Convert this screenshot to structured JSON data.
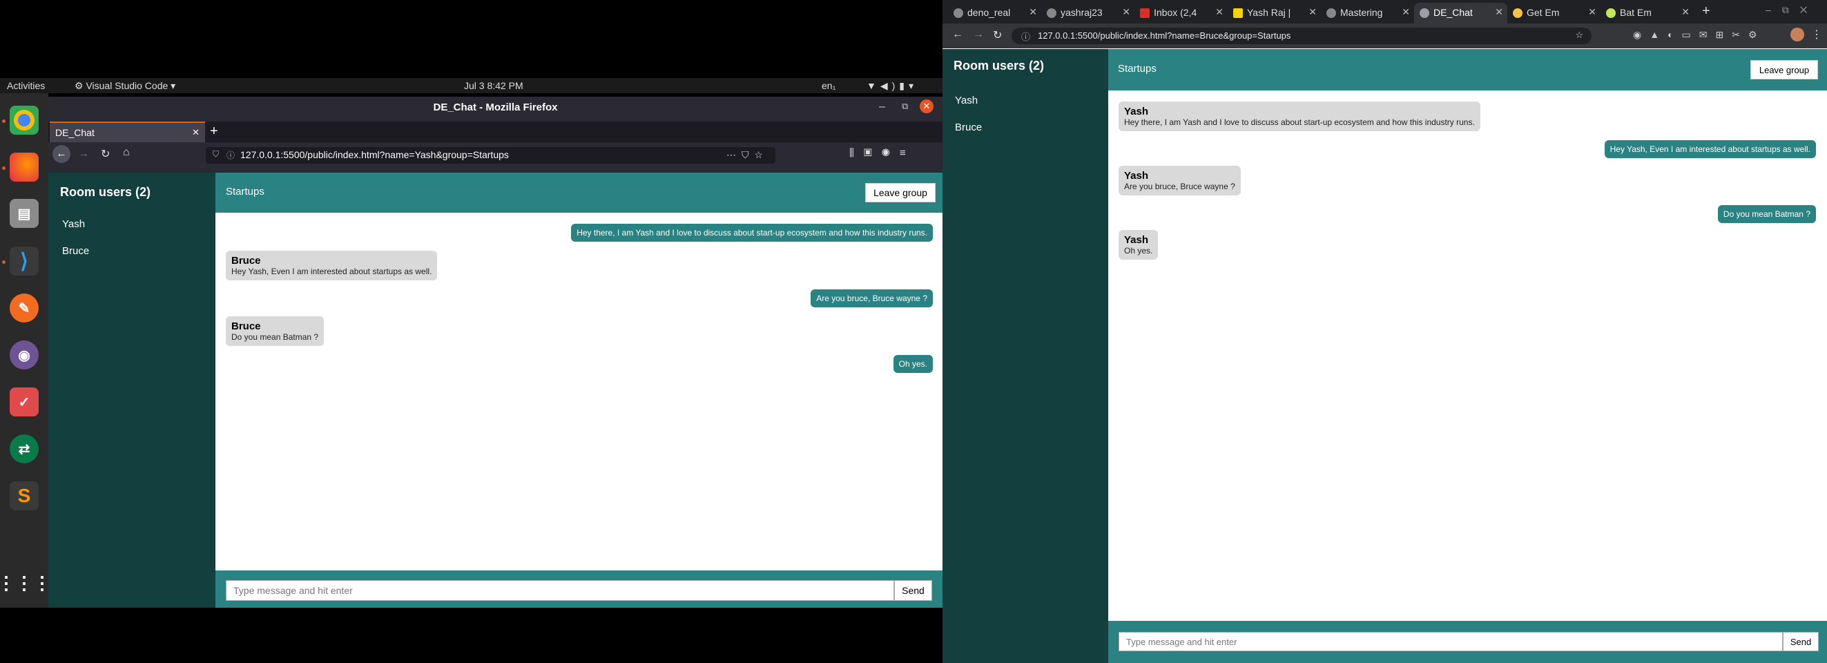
{
  "ubuntu": {
    "activities": "Activities",
    "app_menu": "Visual Studio Code",
    "clock": "Jul 3   8:42 PM",
    "lang": "en₁"
  },
  "firefox": {
    "window_title": "DE_Chat - Mozilla Firefox",
    "tab_title": "DE_Chat",
    "url": "127.0.0.1:5500/public/index.html?name=Yash&group=Startups",
    "chat": {
      "room_users_label": "Room users (2)",
      "users": [
        "Yash",
        "Bruce"
      ],
      "group_name": "Startups",
      "leave_label": "Leave group",
      "messages": [
        {
          "dir": "out",
          "text": "Hey there, I am Yash and I love to discuss about start-up ecosystem and how this industry runs."
        },
        {
          "dir": "in",
          "name": "Bruce",
          "text": "Hey Yash, Even I am interested about startups as well."
        },
        {
          "dir": "out",
          "text": "Are you bruce, Bruce wayne ?"
        },
        {
          "dir": "in",
          "name": "Bruce",
          "text": "Do you mean Batman ?"
        },
        {
          "dir": "out",
          "text": "Oh yes."
        }
      ],
      "input_placeholder": "Type message and hit enter",
      "send_label": "Send"
    }
  },
  "chrome": {
    "tabs": [
      "deno_real",
      "yashraj23",
      "Inbox (2,4",
      "Yash Raj |",
      "Mastering",
      "DE_Chat",
      "Get Em",
      "Bat Em"
    ],
    "url": "127.0.0.1:5500/public/index.html?name=Bruce&group=Startups",
    "chat": {
      "room_users_label": "Room users (2)",
      "users": [
        "Yash",
        "Bruce"
      ],
      "group_name": "Startups",
      "leave_label": "Leave group",
      "messages": [
        {
          "dir": "in",
          "name": "Yash",
          "text": "Hey there, I am Yash and I love to discuss about start-up ecosystem and how this industry runs."
        },
        {
          "dir": "out",
          "text": "Hey Yash, Even I am interested about startups as well."
        },
        {
          "dir": "in",
          "name": "Yash",
          "text": "Are you bruce, Bruce wayne ?"
        },
        {
          "dir": "out",
          "text": "Do you mean Batman ?"
        },
        {
          "dir": "in",
          "name": "Yash",
          "text": "Oh yes."
        }
      ],
      "input_placeholder": "Type message and hit enter",
      "send_label": "Send"
    }
  },
  "colors": {
    "teal": "#2a8282",
    "dark_teal": "#133f3f",
    "bubble_in": "#d9d9d9"
  }
}
